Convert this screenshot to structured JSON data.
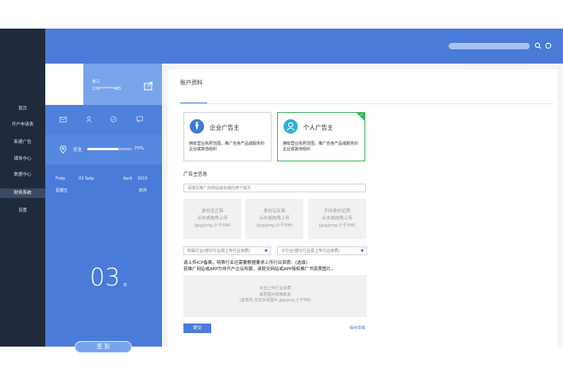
{
  "nav": {
    "items": [
      {
        "label": "首页"
      },
      {
        "label": "开户申请表"
      },
      {
        "label": "新建广告"
      },
      {
        "label": "媒体中心"
      },
      {
        "label": "数据中心"
      },
      {
        "label": "财务系统"
      },
      {
        "label": "设置"
      }
    ],
    "active_index": 5
  },
  "user": {
    "name": "张三",
    "phone": "139*******485"
  },
  "security": {
    "label": "安全",
    "percent_text": "70%",
    "level": 0.7
  },
  "calendar": {
    "weekday_en": "Fridy",
    "date_en": "03 Setp",
    "month_en": "April",
    "year": "2015",
    "weekday_cn": "星期五",
    "month_cn": "四月",
    "day": "03",
    "day_unit": "日",
    "checkin_label": "签 到"
  },
  "page": {
    "title": "账户资料"
  },
  "account_types": [
    {
      "label": "企业广告主",
      "desc": "拥有营业执照范围，推广自身产品或服务的企业或其他组织",
      "selected": false
    },
    {
      "label": "个人广告主",
      "desc": "拥有营业执照范围，推广自身产品或服务的企业或其他组织",
      "selected": true
    }
  ],
  "form": {
    "section_title": "广告主信息",
    "website_placeholder": "请填写推广的网站域名或应用下载页",
    "uploads": [
      {
        "title": "身份证正面",
        "line2": "点击或拖拽上传",
        "line3": "(jpg/png,小于5M)"
      },
      {
        "title": "身份证反面",
        "line2": "点击或拖拽上传",
        "line3": "(jpg/png,小于5M)"
      },
      {
        "title": "手持身份证照",
        "line2": "点击或拖拽上传",
        "line3": "(jpg/png,小于5M)"
      }
    ],
    "industry_select": "所属行业(部分行业需上传行业资质)",
    "subindustry_select": "子行业(部分行业需上传行业资质)",
    "note_line1": "请上传ICP备案，特殊行业还需要根据要求上传行业资质：(选填)",
    "note_line2": "若推广网站或APP为非开户企业所属，请提交网站或APP授权推广书资质图片。",
    "bigupload": {
      "line1": "点击上传行业资质",
      "line2": "或把图片拖拽到此",
      "line3": "(选填项,支持多张图片,jpg/png,小于5M)"
    },
    "submit_label": "提交",
    "save_label": "保存草稿"
  },
  "colors": {
    "primary": "#4a7bd8",
    "nav_bg": "#1f2b3d",
    "selected_border": "#3bb35a"
  }
}
